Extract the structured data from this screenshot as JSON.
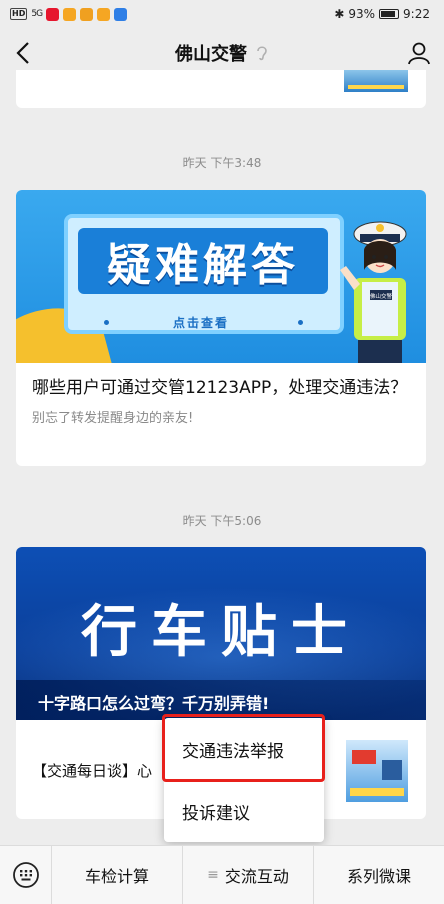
{
  "status_bar": {
    "left_hd": "HD",
    "left_signal": "5G",
    "battery": "93%",
    "time": "9:22"
  },
  "nav": {
    "title": "佛山交警"
  },
  "feed": {
    "timestamp1": "昨天 下午3:48",
    "article1": {
      "banner_title": "疑难解答",
      "banner_sub": "点击查看",
      "badge_text": "佛山交警",
      "title": "哪些用户可通过交管12123APP，处理交通违法？",
      "desc": "别忘了转发提醒身边的亲友!"
    },
    "timestamp2": "昨天 下午5:06",
    "article2": {
      "banner_title": "行车贴士",
      "banner_sub": "十字路口怎么过弯？千万别弄错!",
      "sub_item": "【交通每日谈】心"
    }
  },
  "popup_menu": {
    "items": [
      "交通违法举报",
      "投诉建议"
    ]
  },
  "bottom_menu": {
    "items": [
      {
        "label": "车检计算"
      },
      {
        "label": "交流互动",
        "glyph": "≡"
      },
      {
        "label": "系列微课"
      }
    ]
  },
  "colors": {
    "highlight": "#e8201b",
    "background": "#ededed"
  },
  "icons": [
    "back-arrow-icon",
    "ear-icon",
    "user-icon",
    "keyboard-icon",
    "battery-icon",
    "bluetooth-icon"
  ]
}
